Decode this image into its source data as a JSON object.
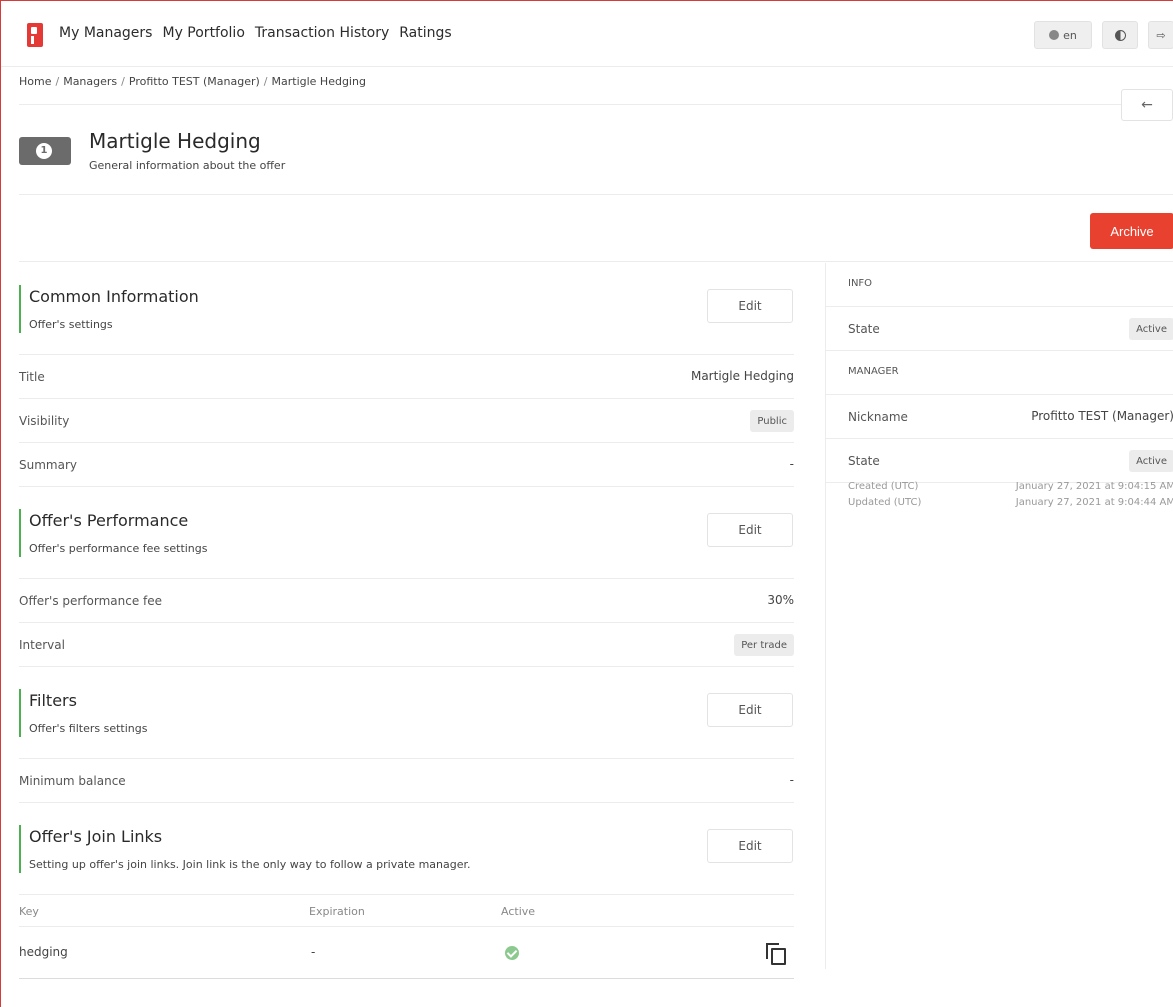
{
  "nav": {
    "items": [
      "My Managers",
      "My Portfolio",
      "Transaction History",
      "Ratings"
    ],
    "language": "en"
  },
  "breadcrumb": [
    "Home",
    "Managers",
    "Profitto TEST (Manager)",
    "Martigle Hedging"
  ],
  "header": {
    "title": "Martigle Hedging",
    "subtitle": "General information about the offer"
  },
  "actions": {
    "archive_label": "Archive",
    "edit_label": "Edit"
  },
  "common": {
    "title": "Common Information",
    "subtitle": "Offer's settings",
    "title_label": "Title",
    "title_value": "Martigle Hedging",
    "visibility_label": "Visibility",
    "visibility_value": "Public",
    "summary_label": "Summary",
    "summary_value": "-"
  },
  "performance": {
    "title": "Offer's Performance",
    "subtitle": "Offer's performance fee settings",
    "fee_label": "Offer's performance fee",
    "fee_value": "30%",
    "interval_label": "Interval",
    "interval_value": "Per trade"
  },
  "filters": {
    "title": "Filters",
    "subtitle": "Offer's filters settings",
    "min_balance_label": "Minimum balance",
    "min_balance_value": "-"
  },
  "join_links": {
    "title": "Offer's Join Links",
    "subtitle": "Setting up offer's join links. Join link is the only way to follow a private manager.",
    "columns": [
      "Key",
      "Expiration",
      "Active"
    ],
    "rows": [
      {
        "key": "hedging",
        "expiration": "-"
      }
    ]
  },
  "info": {
    "heading": "INFO",
    "state_label": "State",
    "state_value": "Active"
  },
  "manager": {
    "heading": "MANAGER",
    "nickname_label": "Nickname",
    "nickname_value": "Profitto TEST (Manager)",
    "state_label": "State",
    "state_value": "Active"
  },
  "meta": {
    "created_label": "Created (UTC)",
    "created_value": "January 27, 2021 at 9:04:15 AM",
    "updated_label": "Updated (UTC)",
    "updated_value": "January 27, 2021 at 9:04:44 AM"
  },
  "colors": {
    "accent_red": "#e8412f",
    "section_bar": "#4caf50",
    "active_check": "#8bc98e"
  }
}
